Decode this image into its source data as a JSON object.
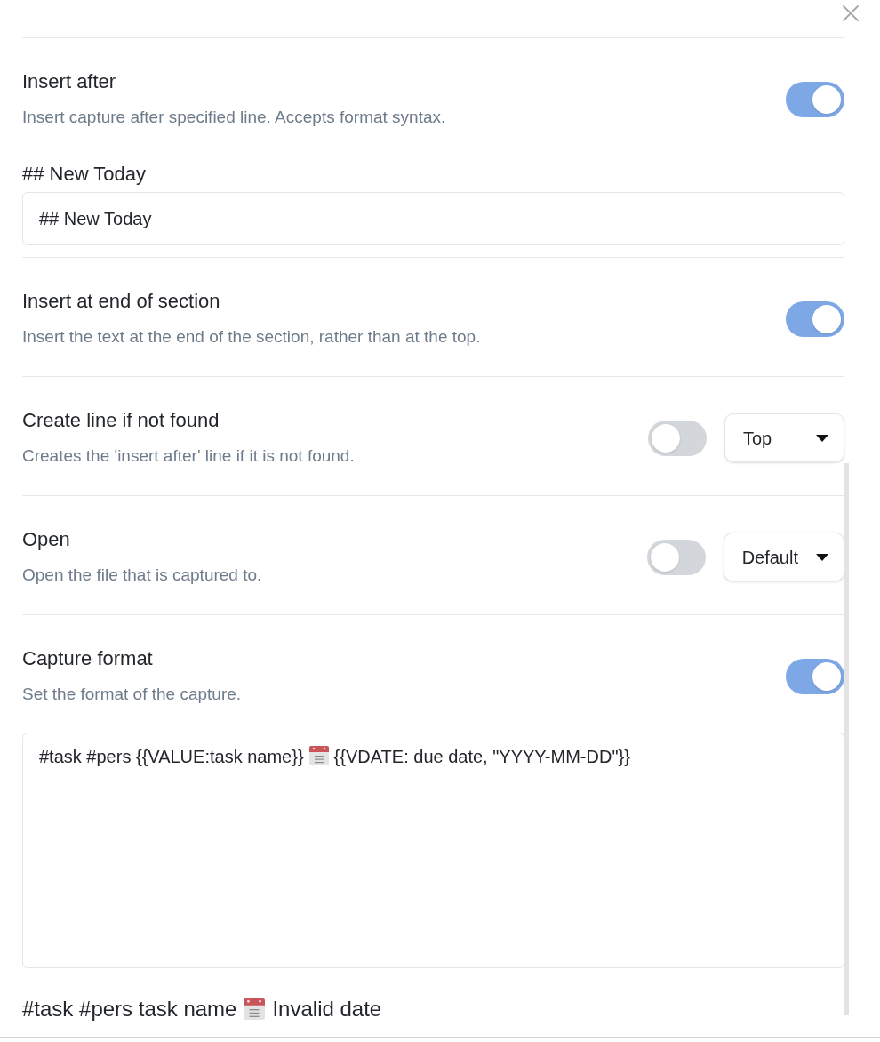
{
  "settings": [
    {
      "kind": "toggle",
      "title": "Insert after",
      "description": "Insert capture after specified line. Accepts format syntax.",
      "on": true,
      "text_field": {
        "label": "## New Today",
        "value": "## New Today"
      }
    },
    {
      "kind": "toggle",
      "title": "Insert at end of section",
      "description": "Insert the text at the end of the section, rather than at the top.",
      "on": true
    },
    {
      "kind": "toggle_dropdown",
      "title": "Create line if not found",
      "description": "Creates the 'insert after' line if it is not found.",
      "on": false,
      "dropdown": {
        "value": "Top"
      }
    },
    {
      "kind": "toggle_dropdown",
      "title": "Open",
      "description": "Open the file that is captured to.",
      "on": false,
      "dropdown": {
        "value": "Default"
      }
    },
    {
      "kind": "toggle",
      "title": "Capture format",
      "description": "Set the format of the capture.",
      "on": true,
      "format_field": {
        "text_before": "#task #pers {{VALUE:task name}}",
        "text_after": "{{VDATE: due date, \"YYYY-MM-DD\"}}"
      },
      "preview": {
        "text_before": "#task #pers task name",
        "text_after": "Invalid date"
      }
    }
  ]
}
